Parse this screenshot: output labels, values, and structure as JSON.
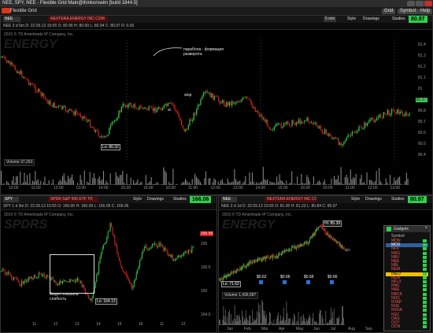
{
  "window": {
    "title": "NEE, SPY, NEE - Flexible Grid Main@thinkorswim [build 1844.5]",
    "subtitle": "Flexible Grid"
  },
  "menubar": {
    "items": [
      "Grid",
      "Symbol",
      "Help"
    ]
  },
  "main_chart": {
    "symbol": "NEE",
    "name": "NEXTERA ENERGY INC COM",
    "price": "80.97",
    "buttons": {
      "style": "Style",
      "drawings": "Drawings",
      "studies": "Studies",
      "period": "5 min"
    },
    "subheader": "NEE 3 d 5m   D: 22.09.13 15:55   O: 80.96   H: 80.99   L: 80.94   C: 80.97   R: 0.06",
    "copyright": "2015 © TD Ameritrade IP Company, Inc.",
    "watermark": "ENERGY",
    "annotation_reversal": "парабола - формация\nразворота",
    "annotation_stop": "stop",
    "annotation_sl": "sl.",
    "low_label": "Lo: 80.32",
    "price_tag": "80.97",
    "price_ticks": [
      "81.4",
      "81.3",
      "81.2",
      "81.1",
      "81",
      "80.9",
      "80.8",
      "80.7",
      "80.6",
      "80.5",
      "80.4"
    ],
    "time_ticks": [
      "10:00",
      "11:00",
      "12:00",
      "13:00",
      "14:00",
      "15:00",
      "16:00",
      "10:00",
      "11:00",
      "12:00",
      "13:00",
      "14:00",
      "15:00",
      "16:00",
      "10:00",
      "11:00",
      "12:00",
      "13:00"
    ],
    "volume_label": "Volume",
    "volume_value": "37,263"
  },
  "spy_chart": {
    "symbol": "SPY",
    "name": "SPDR S&P 500 ETF TR",
    "price": "166.06",
    "buttons": {
      "style": "Style",
      "drawings": "Drawings",
      "studies": "Studies"
    },
    "subheader": "SPY 1 d 5m   D: 22.09.13 15:55   O: 166.06   H: 166.09   L: 166.05   C: 166.06",
    "copyright": "2015 © TD Ameritrade IP Company, Inc.",
    "watermark": "SPDRS",
    "annotation": "Акция показала\nслабость",
    "low_label": "Lo: 164.13",
    "price_tag": "165.56",
    "price_ticks": [
      "166",
      "165.5",
      "165",
      "164.5"
    ],
    "time_ticks": [
      "11",
      "12",
      "13",
      "14",
      "15",
      "16",
      "11",
      "12"
    ]
  },
  "nee_daily": {
    "symbol": "NEE",
    "name": "NEXTERA ENERGY INC COM",
    "price": "80.97",
    "buttons": {
      "style": "Style",
      "drawings": "Drawings",
      "studies": "Studies"
    },
    "subheader": "NEE 3 d 1d   D: 22.09.13 15:55   O: 81.00   H: 81.23   L: 80.84   C: 80.97",
    "copyright": "2015 © TD Ameritrade IP Company, Inc.",
    "watermark": "ENERGY",
    "hi_label": "Hi: 85.39",
    "low_label": "Lo: 71.62",
    "dividends": [
      "$0.62",
      "$0.66",
      "$0.66",
      "$0.66"
    ],
    "volume_label": "Volume",
    "volume_value": "1,436,687",
    "time_ticks": [
      "Jan",
      "Feb",
      "Mar",
      "Apr",
      "May",
      "Jun",
      "Jul",
      "Aug",
      "Sep"
    ]
  },
  "watchlist": {
    "title": "Gadgets",
    "header": "Symbol",
    "rows": [
      {
        "symbol": "MON",
        "color": "#ff5a5a"
      },
      {
        "symbol": "MOS",
        "color": "#ffffff",
        "selected": true
      },
      {
        "symbol": "NFX",
        "color": "#ff5a5a"
      },
      {
        "symbol": "NRG",
        "color": "#ff5a5a"
      },
      {
        "symbol": "NBV",
        "color": "#ff5a5a"
      },
      {
        "symbol": "NEE",
        "color": "#ff5a5a"
      },
      {
        "symbol": "NBL",
        "color": "#ff5a5a"
      },
      {
        "symbol": "NEM",
        "color": "#ff5a5a"
      },
      {
        "symbol": "INED",
        "color": "#000000",
        "highlight": "#f0c000"
      },
      {
        "symbol": "NEM",
        "color": "#ff5a5a"
      },
      {
        "symbol": "NFLX",
        "color": "#ff5a5a"
      },
      {
        "symbol": "NWL",
        "color": "#ff5a5a"
      },
      {
        "symbol": "NKE",
        "color": "#ff5a5a"
      },
      {
        "symbol": "NBCK",
        "color": "#ff5a5a"
      },
      {
        "symbol": "NOC",
        "color": "#ff5a5a"
      },
      {
        "symbol": "NTAP",
        "color": "#ff5a5a"
      },
      {
        "symbol": "NUE",
        "color": "#ff5a5a"
      },
      {
        "symbol": "NVDA",
        "color": "#ff5a5a"
      },
      {
        "symbol": "NSC",
        "color": "#ff5a5a"
      },
      {
        "symbol": "OAS",
        "color": "#ff5a5a"
      },
      {
        "symbol": "OXY",
        "color": "#ff5a5a"
      },
      {
        "symbol": "OCN",
        "color": "#ff5a5a"
      }
    ]
  },
  "colors": {
    "up": "#2fd04a",
    "down": "#e02020",
    "bg": "#000000"
  }
}
